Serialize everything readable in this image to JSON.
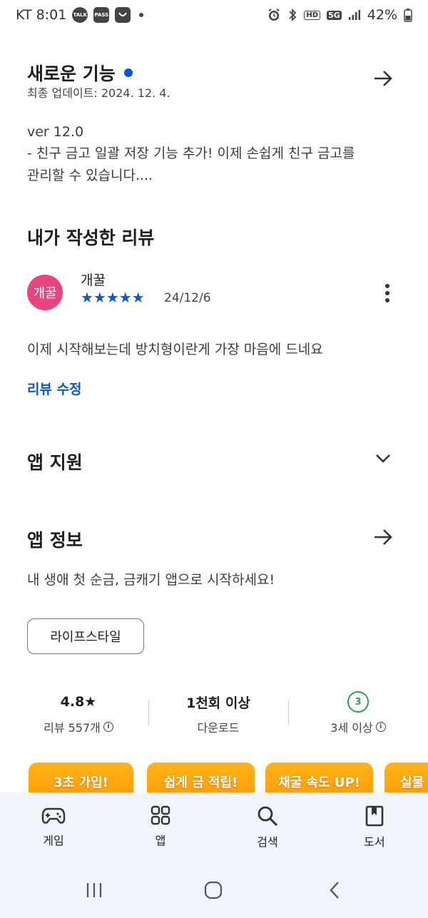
{
  "status_bar": {
    "carrier_time": "KT 8:01",
    "talk_badge": "TALK",
    "pass_badge": "PASS",
    "battery": "42%",
    "hd_badge": "HD",
    "network_badge": "5G",
    "icons": [
      "kakaotalk-icon",
      "pass-icon",
      "store-icon",
      "alarm-icon",
      "bluetooth-icon",
      "hd-icon",
      "5g-icon",
      "signal-icon",
      "battery-icon"
    ]
  },
  "whats_new": {
    "title": "새로운 기능",
    "updated": "최종 업데이트: 2024. 12. 4.",
    "version": "ver 12.0",
    "line1": "- 친구 금고 일괄 저장 기능 추가! 이제 손쉽게 친구 금고를",
    "line2": "관리할 수 있습니다...."
  },
  "my_review": {
    "title": "내가 작성한 리뷰",
    "avatar_text": "개꿀",
    "user_name": "개꿀",
    "rating": 5,
    "stars": "★★★★★",
    "date": "24/12/6",
    "text": "이제 시작해보는데 방치형이란게 가장 마음에 드네요",
    "edit_link": "리뷰 수정"
  },
  "app_support": {
    "title": "앱 지원"
  },
  "app_info": {
    "title": "앱 정보",
    "description": "내 생애 첫 순금, 금캐기 앱으로 시작하세요!",
    "category_chip": "라이프스타일"
  },
  "stats": {
    "rating_value": "4.8★",
    "rating_label": "리뷰 557개",
    "downloads_value": "1천회 이상",
    "downloads_label": "다운로드",
    "age_badge": "3",
    "age_label": "3세 이상"
  },
  "banners": [
    "3초 가입!",
    "쉽게 금 적립!",
    "채굴 속도 UP!",
    "실물"
  ],
  "bottom_nav": {
    "items": [
      {
        "label": "게임",
        "icon": "gamepad-icon"
      },
      {
        "label": "앱",
        "icon": "apps-grid-icon"
      },
      {
        "label": "검색",
        "icon": "search-icon"
      },
      {
        "label": "도서",
        "icon": "book-icon"
      }
    ]
  },
  "colors": {
    "accent_blue": "#0b57d0",
    "avatar_pink": "#e8447f",
    "age_green": "#2e9e4f",
    "banner_orange": "#ff9a00",
    "nav_background": "#f1f4fb"
  }
}
